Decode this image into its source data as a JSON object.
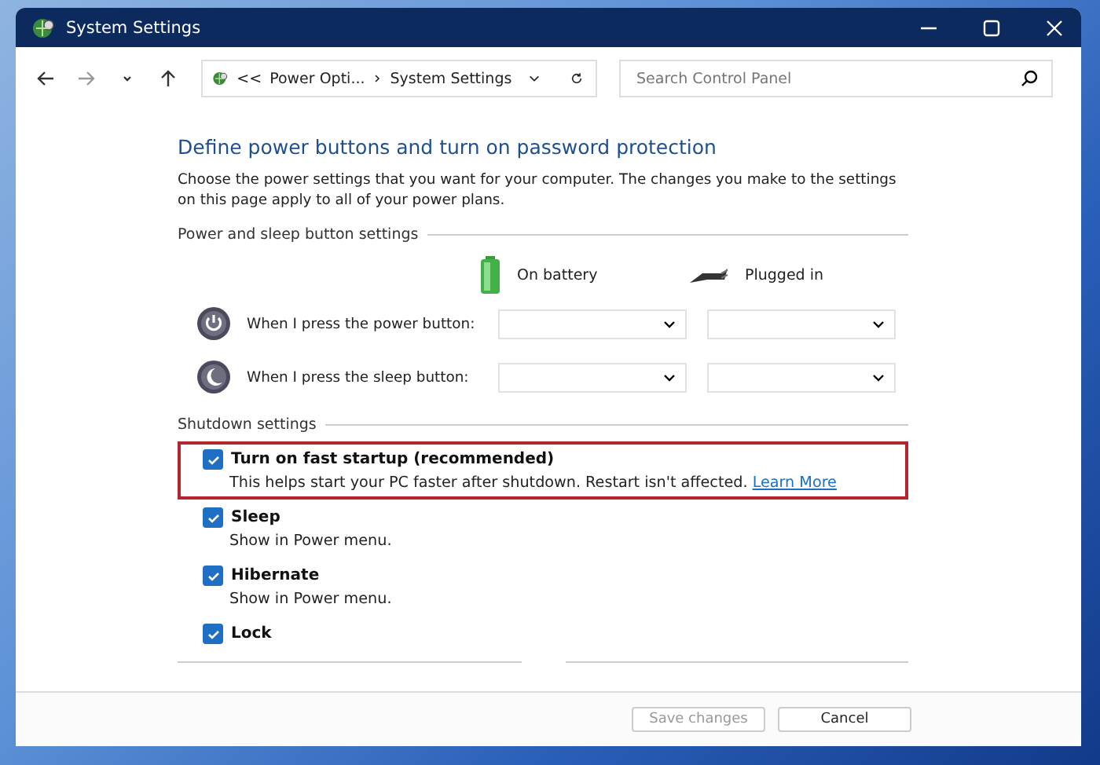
{
  "window": {
    "title": "System Settings"
  },
  "address_bar": {
    "overflow": "<<",
    "crumbs": [
      "Power Opti...",
      "System Settings"
    ]
  },
  "search": {
    "placeholder": "Search Control Panel"
  },
  "heading": "Define power buttons and turn on password protection",
  "description": "Choose the power settings that you want for your computer. The changes you make to the settings on this page apply to all of your power plans.",
  "power_section": {
    "title": "Power and sleep button settings",
    "columns": [
      "On battery",
      "Plugged in"
    ],
    "rows": [
      {
        "kind": "power",
        "label": "When I press the power button:"
      },
      {
        "kind": "sleep",
        "label": "When I press the sleep button:"
      }
    ]
  },
  "shutdown_section": {
    "title": "Shutdown settings",
    "items": [
      {
        "label": "Turn on fast startup (recommended)",
        "checked": true,
        "highlighted": true,
        "description": "This helps start your PC faster after shutdown. Restart isn't affected.",
        "link": "Learn More"
      },
      {
        "label": "Sleep",
        "checked": true,
        "highlighted": false,
        "description": "Show in Power menu."
      },
      {
        "label": "Hibernate",
        "checked": true,
        "highlighted": false,
        "description": "Show in Power menu."
      },
      {
        "label": "Lock",
        "checked": true,
        "highlighted": false
      }
    ]
  },
  "buttons": [
    {
      "label": "Save changes",
      "disabled": true
    },
    {
      "label": "Cancel",
      "disabled": false
    }
  ]
}
